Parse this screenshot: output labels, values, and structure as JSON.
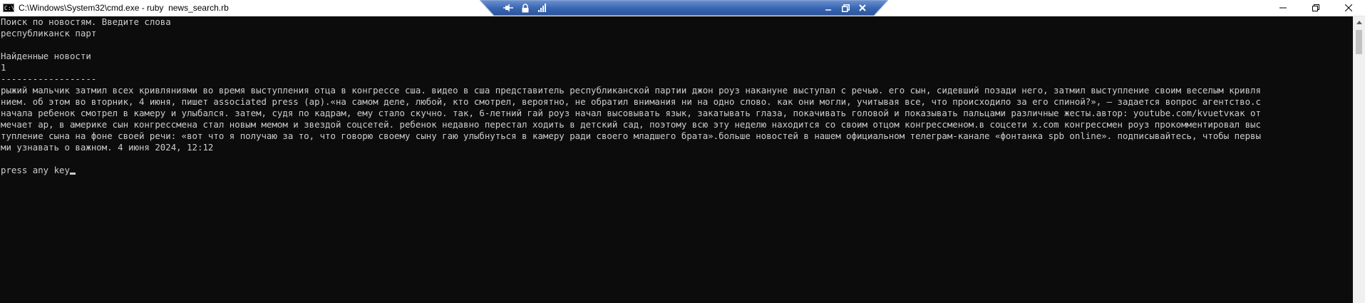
{
  "window": {
    "title": "C:\\Windows\\System32\\cmd.exe - ruby  news_search.rb",
    "app_icon_text": "C:\\",
    "controls": {
      "minimize": "minimize-icon",
      "maximize": "restore-icon",
      "close": "close-icon"
    }
  },
  "connection_bar": {
    "left_icons": [
      "pin-icon",
      "lock-icon",
      "signal-icon"
    ],
    "right_icons": [
      "minimize-icon",
      "restore-icon",
      "close-icon"
    ],
    "color": "#3a68b4"
  },
  "console": {
    "lines": [
      "Поиск по новостям. Введите слова",
      "республиканск парт",
      "",
      "Найденные новости",
      "1",
      "------------------",
      "рыжий мальчик затмил всех кривляниями во время выступления отца в конгрессе сша. видео в сша представитель республиканской партии джон роуз накануне выступал с речью. его сын, сидевший позади него, затмил выступление своим веселым кривля",
      "нием. об этом во вторник, 4 июня, пишет associated press (ap).«на самом деле, любой, кто смотрел, вероятно, не обратил внимания ни на одно слово. как они могли, учитывая все, что происходило за его спиной?», — задается вопрос агентство.с",
      "начала ребенок смотрел в камеру и улыбался. затем, судя по кадрам, ему стало скучно. так, 6-летний гай роуз начал высовывать язык, закатывать глаза, покачивать головой и показывать пальцами различные жесты.автор: youtube.com/kvuetvкак от",
      "мечает ap, в америке сын конгрессмена стал новым мемом и звездой соцсетей. ребенок недавно перестал ходить в детский сад, поэтому всю эту неделю находится со своим отцом конгрессменом.в соцсети x.com конгрессмен роуз прокомментировал выс",
      "тупление сына на фоне своей речи: «вот что я получаю за то, что говорю своему сыну гаю улыбнуться в камеру ради своего младшего брата».больше новостей в нашем официальном телеграм-канале «фонтанка spb online». подписывайтесь, чтобы первы",
      "ми узнавать о важном. 4 июня 2024, 12:12",
      ""
    ],
    "prompt": "press any key",
    "colors": {
      "background": "#0c0c0c",
      "foreground": "#cccccc"
    }
  },
  "scrollbar": {
    "up_arrow": "chevron-up-icon",
    "down_arrow": "chevron-down-icon"
  }
}
